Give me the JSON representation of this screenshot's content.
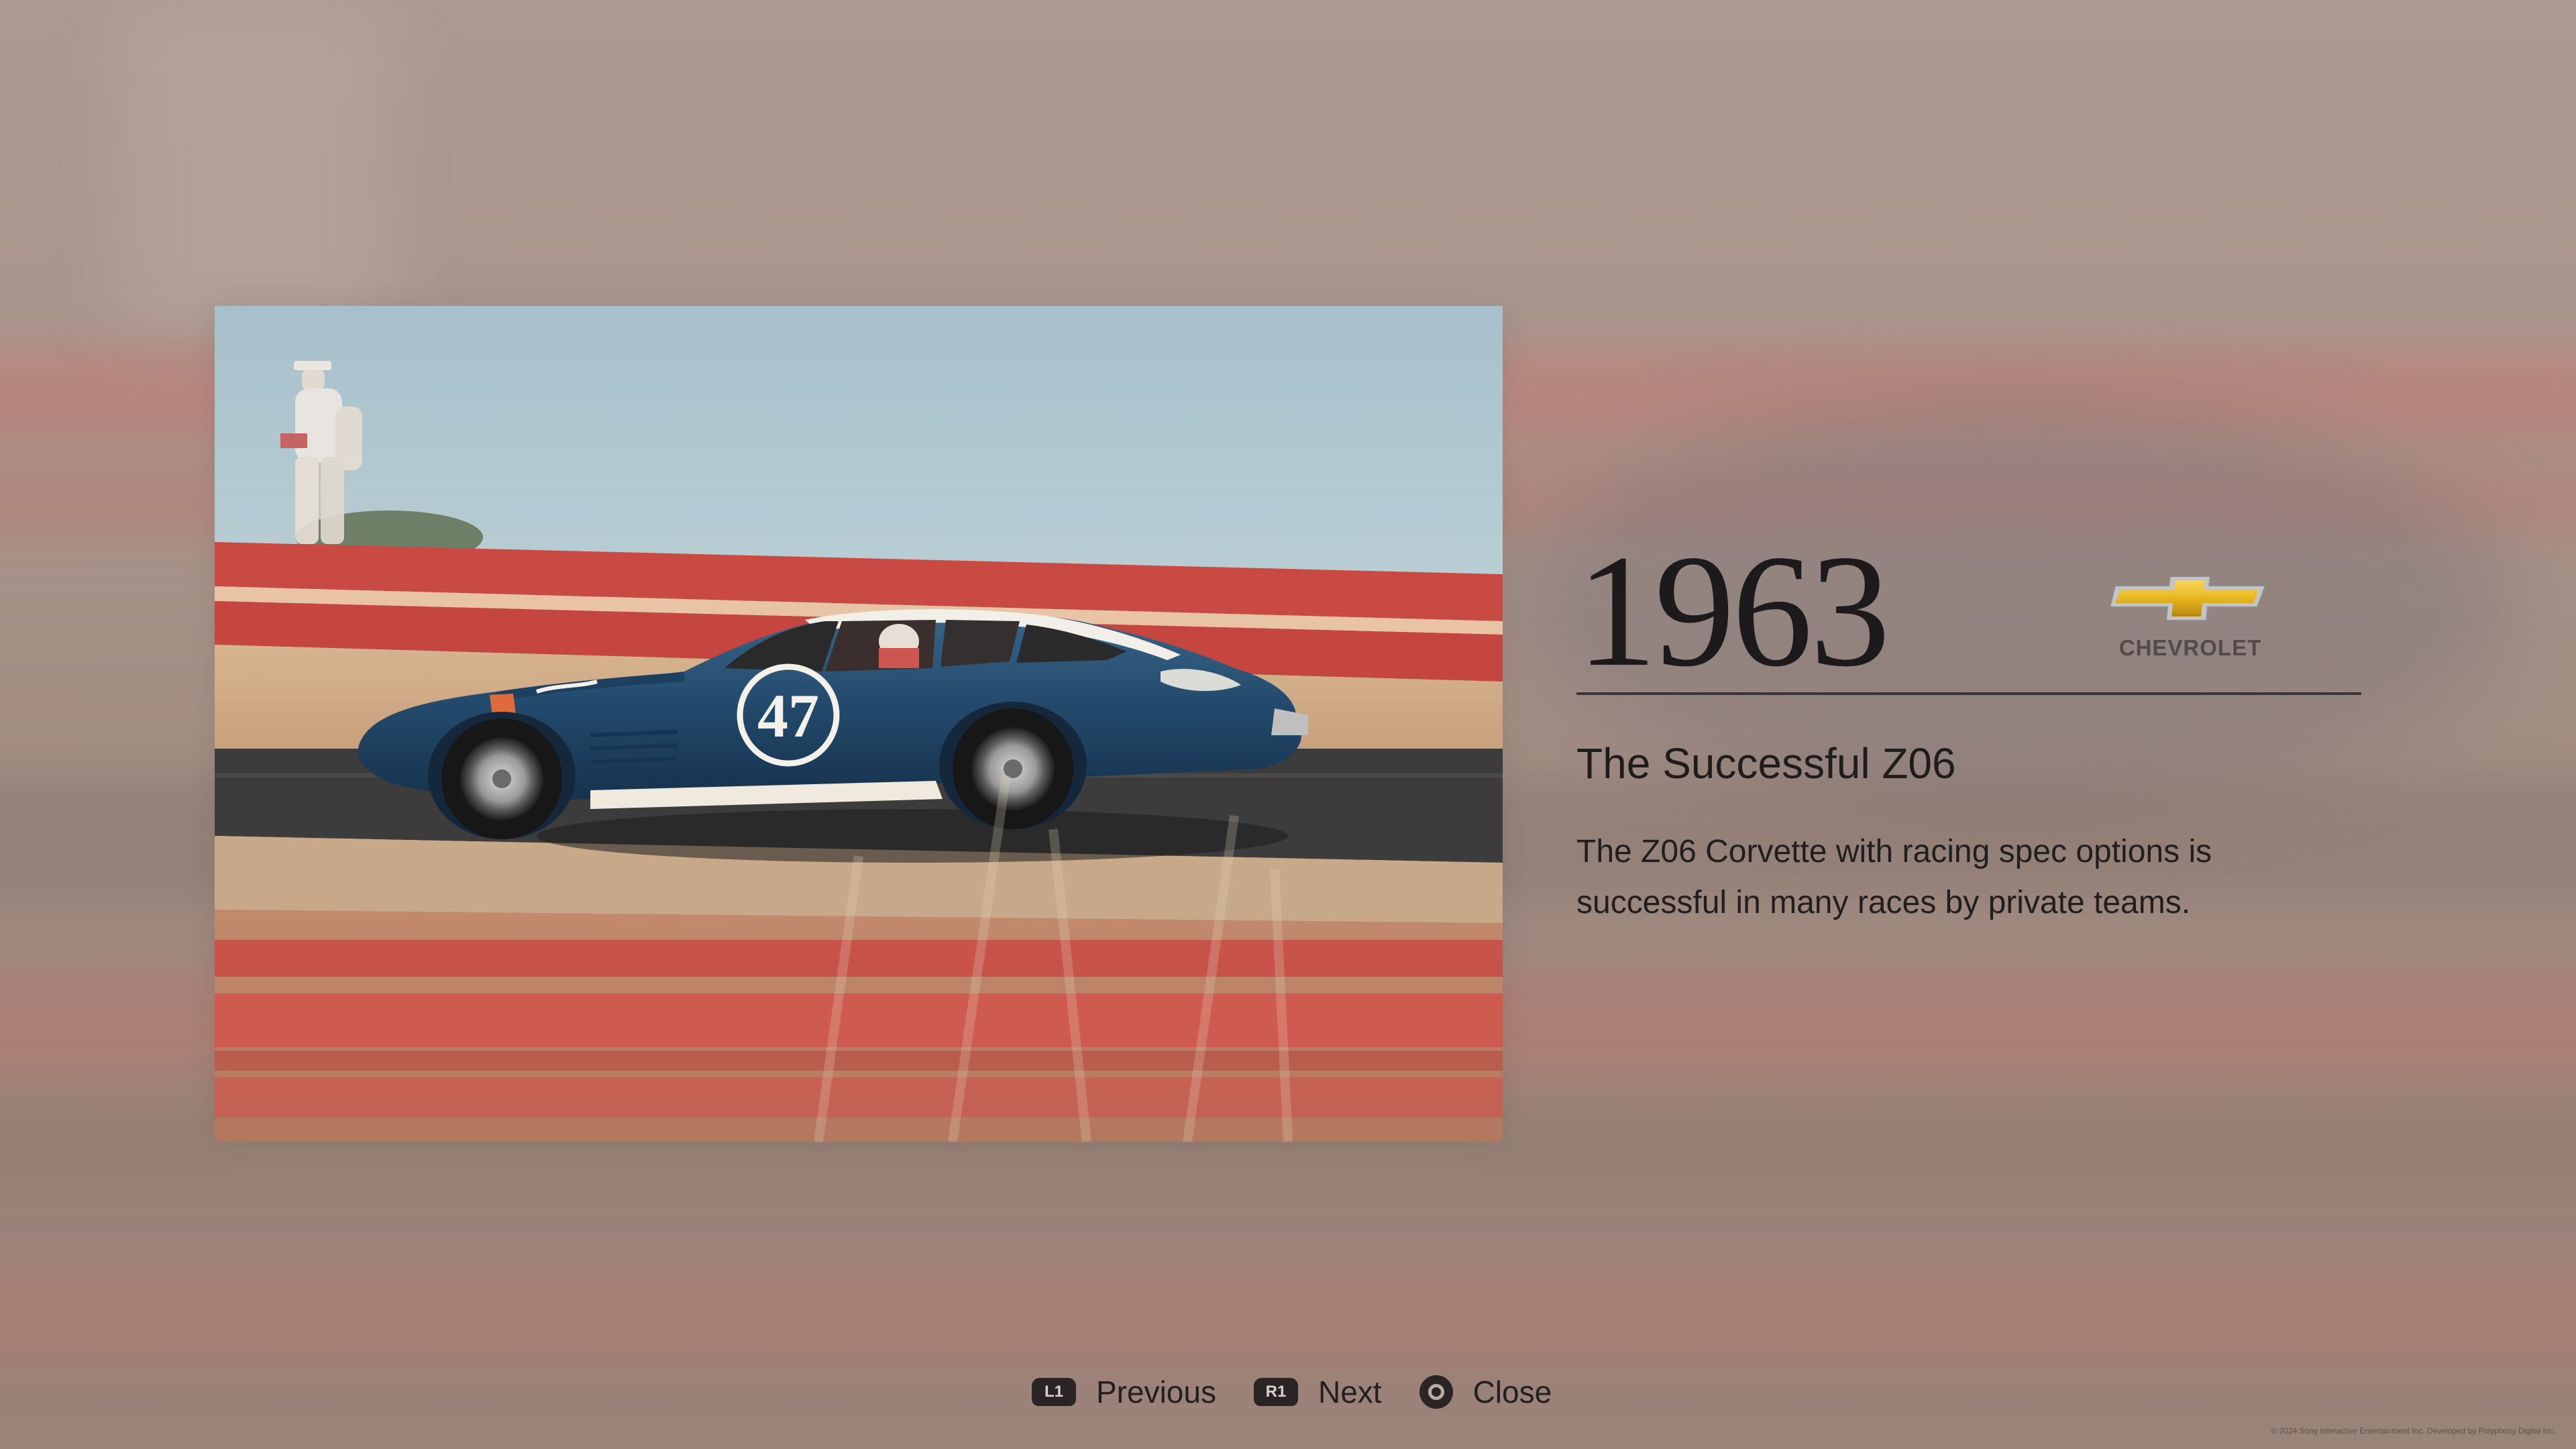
{
  "year": "1963",
  "brand": {
    "name": "CHEVROLET",
    "logo_icon": "chevrolet-bowtie-icon",
    "logo_colors": [
      "#f2c42e",
      "#c79412",
      "#b8b8b8"
    ]
  },
  "photo": {
    "car_number": "47",
    "palette": {
      "sky": "#a9c3cd",
      "barrier": "#c54a42",
      "car_body": "#23486a",
      "track": "#3b3a3a",
      "grass": "#d7b792"
    }
  },
  "title": "The Successful Z06",
  "description": "The Z06 Corvette with racing spec options is successful in many races by private teams.",
  "controls": [
    {
      "button": "L1",
      "label": "Previous",
      "icon": "l1-button-icon"
    },
    {
      "button": "R1",
      "label": "Next",
      "icon": "r1-button-icon"
    },
    {
      "button": "",
      "label": "Close",
      "icon": "circle-button-icon"
    }
  ],
  "copyright": "© 2024 Sony Interactive Entertainment Inc. Developed by Polyphony Digital Inc."
}
